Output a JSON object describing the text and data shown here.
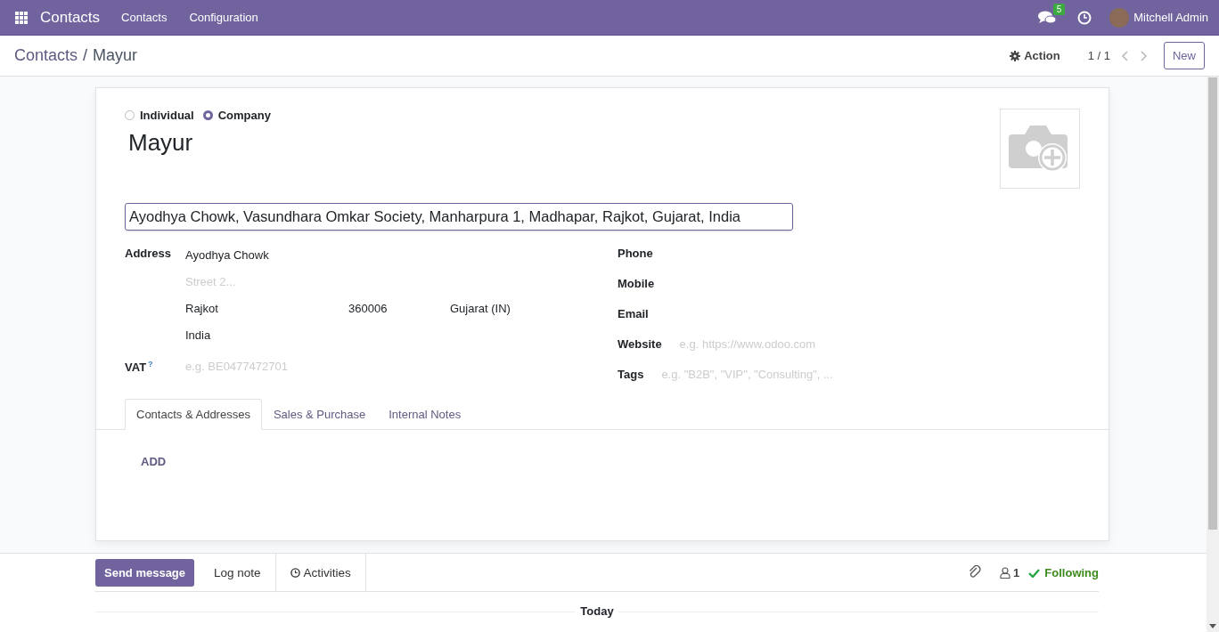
{
  "navbar": {
    "app_name": "Contacts",
    "menu": [
      "Contacts",
      "Configuration"
    ],
    "messages_badge": "5",
    "user": "Mitchell Admin"
  },
  "control_panel": {
    "breadcrumb": [
      "Contacts",
      "Mayur"
    ],
    "separator": "/",
    "action": "Action",
    "pager": "1 / 1",
    "new_button": "New"
  },
  "form": {
    "company_type": [
      {
        "label": "Individual",
        "selected": false
      },
      {
        "label": "Company",
        "selected": true
      }
    ],
    "name": "Mayur",
    "address_search": "Ayodhya Chowk, Vasundhara Omkar Society, Manharpura 1, Madhapar, Rajkot, Gujarat, India",
    "address": {
      "label": "Address",
      "street": "Ayodhya Chowk",
      "street2_placeholder": "Street 2...",
      "city": "Rajkot",
      "zip": "360006",
      "state": "Gujarat (IN)",
      "country": "India"
    },
    "vat": {
      "label": "VAT",
      "help": "?",
      "placeholder": "e.g. BE0477472701"
    },
    "right_fields": [
      {
        "label": "Phone"
      },
      {
        "label": "Mobile"
      },
      {
        "label": "Email"
      },
      {
        "label": "Website",
        "placeholder": "e.g. https://www.odoo.com"
      },
      {
        "label": "Tags",
        "placeholder": "e.g. \"B2B\", \"VIP\", \"Consulting\", ..."
      }
    ],
    "tabs": [
      {
        "label": "Contacts & Addresses",
        "selected": true
      },
      {
        "label": "Sales & Purchase",
        "selected": false
      },
      {
        "label": "Internal Notes",
        "selected": false
      }
    ],
    "add_button": "ADD"
  },
  "chatter": {
    "send_message": "Send message",
    "log_note": "Log note",
    "activities": "Activities",
    "followers": "1",
    "following": "Following",
    "date_separator": "Today"
  }
}
